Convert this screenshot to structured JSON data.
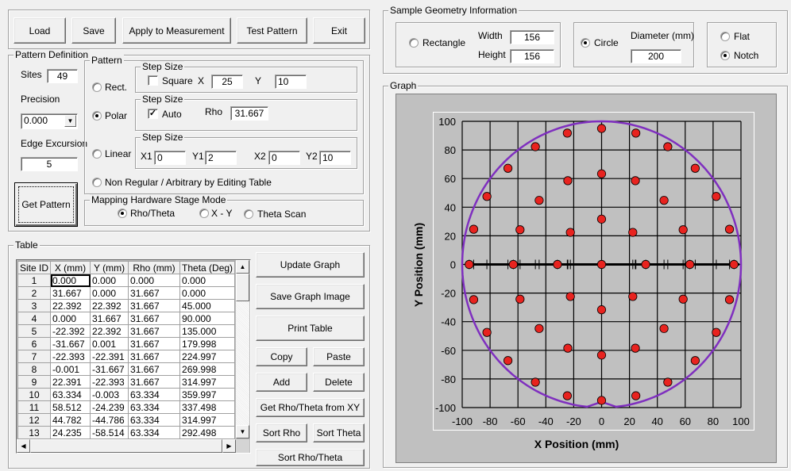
{
  "toolbar": {
    "load": "Load",
    "save": "Save",
    "apply": "Apply to Measurement",
    "test_pattern": "Test Pattern",
    "exit": "Exit"
  },
  "pattern_definition": {
    "title": "Pattern Definition",
    "sites_label": "Sites",
    "sites_value": "49",
    "precision_label": "Precision",
    "precision_value": "0.000",
    "edge_label": "Edge Excursion",
    "edge_value": "5",
    "get_pattern": "Get Pattern",
    "pattern": {
      "title": "Pattern",
      "rect_label": "Rect.",
      "polar_label": "Polar",
      "linear_label": "Linear",
      "nonregular_label": "Non Regular / Arbitrary by Editing Table",
      "selected": "Polar",
      "rect_step": {
        "title": "Step Size",
        "square_label": "Square",
        "square_checked": false,
        "x_label": "X",
        "x_value": "25",
        "y_label": "Y",
        "y_value": "10"
      },
      "polar_step": {
        "title": "Step Size",
        "auto_label": "Auto",
        "auto_checked": true,
        "rho_label": "Rho",
        "rho_value": "31.667"
      },
      "linear_step": {
        "title": "Step Size",
        "x1_label": "X1",
        "x1_value": "0",
        "y1_label": "Y1",
        "y1_value": "2",
        "x2_label": "X2",
        "x2_value": "0",
        "y2_label": "Y2",
        "y2_value": "10"
      }
    },
    "stage_mode": {
      "title": "Mapping Hardware Stage Mode",
      "rho_theta": "Rho/Theta",
      "xy": "X - Y",
      "theta_scan": "Theta Scan",
      "selected": "Rho/Theta"
    }
  },
  "geometry": {
    "title": "Sample Geometry Information",
    "rectangle_label": "Rectangle",
    "width_label": "Width",
    "width_value": "156",
    "height_label": "Height",
    "height_value": "156",
    "circle_label": "Circle",
    "diameter_label": "Diameter (mm)",
    "diameter_value": "200",
    "shape_selected": "Circle",
    "flat_label": "Flat",
    "notch_label": "Notch",
    "edge_selected": "Notch"
  },
  "table": {
    "title": "Table",
    "columns": [
      "Site ID",
      "X (mm)",
      "Y (mm)",
      "Rho (mm)",
      "Theta (Deg)"
    ],
    "rows": [
      [
        "1",
        "0.000",
        "0.000",
        "0.000",
        "0.000"
      ],
      [
        "2",
        "31.667",
        "0.000",
        "31.667",
        "0.000"
      ],
      [
        "3",
        "22.392",
        "22.392",
        "31.667",
        "45.000"
      ],
      [
        "4",
        "0.000",
        "31.667",
        "31.667",
        "90.000"
      ],
      [
        "5",
        "-22.392",
        "22.392",
        "31.667",
        "135.000"
      ],
      [
        "6",
        "-31.667",
        "0.001",
        "31.667",
        "179.998"
      ],
      [
        "7",
        "-22.393",
        "-22.391",
        "31.667",
        "224.997"
      ],
      [
        "8",
        "-0.001",
        "-31.667",
        "31.667",
        "269.998"
      ],
      [
        "9",
        "22.391",
        "-22.393",
        "31.667",
        "314.997"
      ],
      [
        "10",
        "63.334",
        "-0.003",
        "63.334",
        "359.997"
      ],
      [
        "11",
        "58.512",
        "-24.239",
        "63.334",
        "337.498"
      ],
      [
        "12",
        "44.782",
        "-44.786",
        "63.334",
        "314.997"
      ],
      [
        "13",
        "24.235",
        "-58.514",
        "63.334",
        "292.498"
      ]
    ]
  },
  "actions": {
    "update_graph": "Update Graph",
    "save_graph_image": "Save Graph Image",
    "print_table": "Print Table",
    "copy": "Copy",
    "paste": "Paste",
    "add": "Add",
    "delete": "Delete",
    "get_rho_theta": "Get Rho/Theta from XY",
    "sort_rho": "Sort Rho",
    "sort_theta": "Sort Theta",
    "sort_rho_theta": "Sort Rho/Theta"
  },
  "graph": {
    "title": "Graph"
  },
  "chart_data": {
    "type": "scatter",
    "title": "",
    "xlabel": "X Position (mm)",
    "ylabel": "Y Position (mm)",
    "xlim": [
      -100,
      100
    ],
    "ylim": [
      -100,
      100
    ],
    "xticks": [
      -100,
      -80,
      -60,
      -40,
      -20,
      0,
      20,
      40,
      60,
      80,
      100
    ],
    "yticks": [
      -100,
      -80,
      -60,
      -40,
      -20,
      0,
      20,
      40,
      60,
      80,
      100
    ],
    "grid": true,
    "wafer_outline": {
      "shape": "circle",
      "diameter": 200,
      "notch": "bottom",
      "color": "#7f2fbf"
    },
    "point_color": "#e8231f",
    "rings": [
      {
        "rho": 0,
        "count": 1
      },
      {
        "rho": 31.667,
        "count": 8
      },
      {
        "rho": 63.334,
        "count": 16
      },
      {
        "rho": 95.0,
        "count": 24
      }
    ],
    "zero_axis_ticks_x": [
      -95,
      -91.8,
      -82.3,
      -67.2,
      -63.3,
      -58.5,
      -47.5,
      -44.8,
      -31.7,
      -24.6,
      -24.2,
      -22.4,
      0,
      22.4,
      24.2,
      24.6,
      31.7,
      44.8,
      47.5,
      58.5,
      63.3,
      67.2,
      82.3,
      91.8,
      95
    ]
  }
}
